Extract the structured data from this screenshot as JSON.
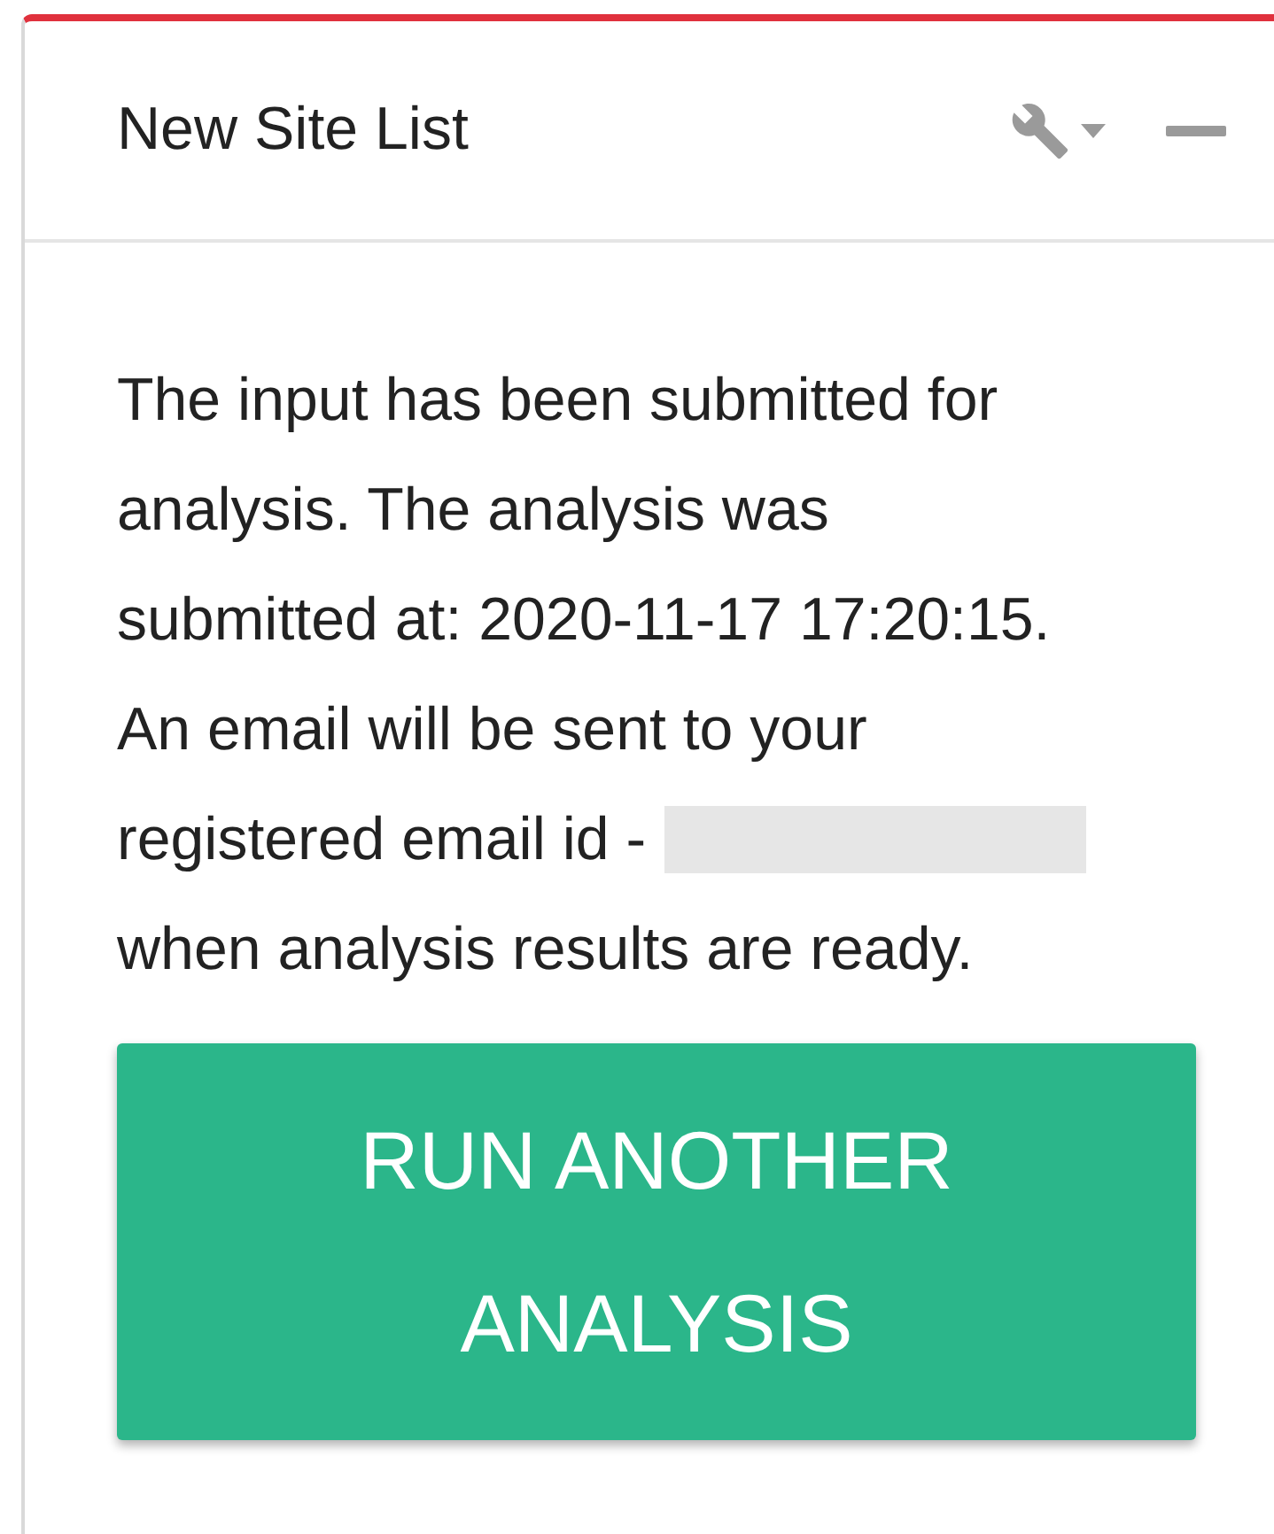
{
  "panel": {
    "title": "New Site List",
    "message_lines": [
      "The input has been submitted for",
      "analysis. The analysis was",
      "submitted at: 2020-11-17 17:20:15.",
      "An email will be sent to your",
      "registered email id -",
      "when analysis results are ready."
    ],
    "button": "RUN ANOTHER ANALYSIS"
  }
}
